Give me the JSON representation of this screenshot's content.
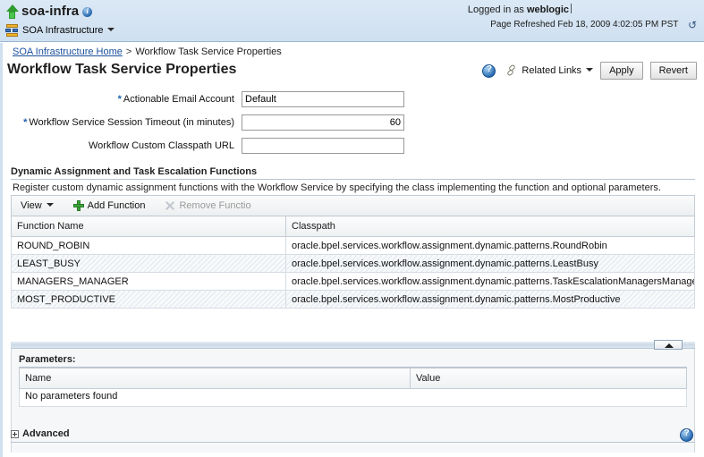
{
  "banner": {
    "app_title": "soa-infra",
    "app_status_icon": "green-up-arrow-icon",
    "info_icon": "info-icon",
    "infra_menu_label": "SOA Infrastructure",
    "logged_in_prefix": "Logged in as",
    "logged_in_user": "weblogic",
    "refreshed_text": "Page Refreshed Feb 18, 2009 4:02:05 PM PST",
    "refresh_icon": "refresh-icon"
  },
  "breadcrumb": {
    "home_label": "SOA Infrastructure Home",
    "separator": ">",
    "current_label": "Workflow Task Service Properties"
  },
  "page": {
    "title": "Workflow Task Service Properties"
  },
  "actions": {
    "help_icon": "help-icon",
    "related_links_label": "Related Links",
    "apply_label": "Apply",
    "revert_label": "Revert"
  },
  "form": {
    "fields": [
      {
        "label": "Actionable Email Account",
        "required": true,
        "value": "Default",
        "align": "left"
      },
      {
        "label": "Workflow Service Session Timeout (in minutes)",
        "required": true,
        "value": "60",
        "align": "right"
      },
      {
        "label": "Workflow Custom Classpath URL",
        "required": false,
        "value": "",
        "align": "left"
      }
    ]
  },
  "functions_section": {
    "heading": "Dynamic Assignment and Task Escalation Functions",
    "description": "Register custom dynamic assignment functions with the Workflow Service by specifying the class implementing the function and optional parameters.",
    "toolbar": {
      "view_label": "View",
      "add_label": "Add Function",
      "remove_label": "Remove Functio"
    },
    "columns": [
      "Function Name",
      "Classpath"
    ],
    "rows": [
      {
        "name": "ROUND_ROBIN",
        "classpath": "oracle.bpel.services.workflow.assignment.dynamic.patterns.RoundRobin"
      },
      {
        "name": "LEAST_BUSY",
        "classpath": "oracle.bpel.services.workflow.assignment.dynamic.patterns.LeastBusy"
      },
      {
        "name": "MANAGERS_MANAGER",
        "classpath": "oracle.bpel.services.workflow.assignment.dynamic.patterns.TaskEscalationManagersManager"
      },
      {
        "name": "MOST_PRODUCTIVE",
        "classpath": "oracle.bpel.services.workflow.assignment.dynamic.patterns.MostProductive"
      }
    ]
  },
  "parameters_section": {
    "title": "Parameters:",
    "columns": [
      "Name",
      "Value"
    ],
    "empty_message": "No parameters found"
  },
  "advanced": {
    "label": "Advanced",
    "expanded": false
  },
  "footer": {
    "help_icon": "help-icon"
  },
  "colors": {
    "banner_bg": "#d7e5f2",
    "link": "#1a4f9c",
    "required_marker": "#1c61ab",
    "accent_green": "#3ca63c"
  }
}
